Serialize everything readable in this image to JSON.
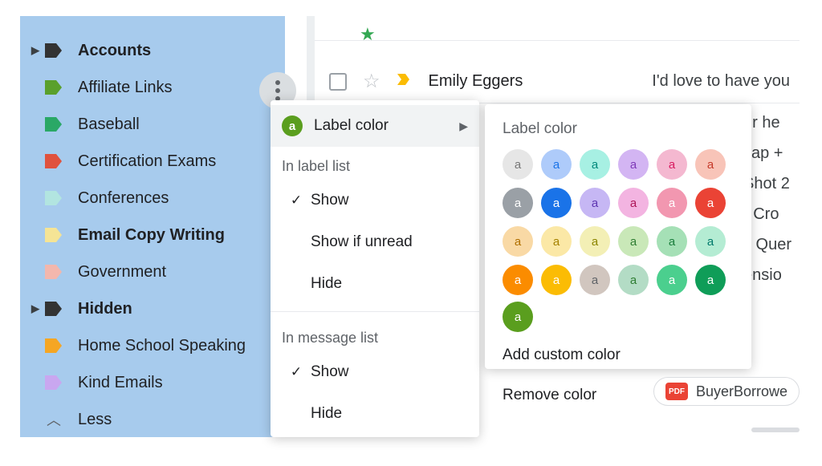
{
  "sidebar": {
    "items": [
      {
        "label": "Accounts",
        "color": "#333333",
        "bold": true,
        "expandable": true
      },
      {
        "label": "Affiliate Links",
        "color": "#5aa02c",
        "bold": false,
        "expandable": false
      },
      {
        "label": "Baseball",
        "color": "#2aa866",
        "bold": false,
        "expandable": false
      },
      {
        "label": "Certification Exams",
        "color": "#e0523e",
        "bold": false,
        "expandable": false
      },
      {
        "label": "Conferences",
        "color": "#b2e5e0",
        "bold": false,
        "expandable": false
      },
      {
        "label": "Email Copy Writing",
        "color": "#f5e495",
        "bold": true,
        "expandable": false
      },
      {
        "label": "Government",
        "color": "#f3b7ad",
        "bold": false,
        "expandable": false
      },
      {
        "label": "Hidden",
        "color": "#333333",
        "bold": true,
        "expandable": true
      },
      {
        "label": "Home School Speaking",
        "color": "#f5a623",
        "bold": false,
        "expandable": false
      },
      {
        "label": "Kind Emails",
        "color": "#c9a7f0",
        "bold": false,
        "expandable": false
      }
    ],
    "less": "Less"
  },
  "mail_row": {
    "sender": "Emily Eggers",
    "subject": "I'd love to have you"
  },
  "peek_snippets": [
    "ur he",
    "cap +",
    "Shot 2",
    "r Cro",
    "s Quer",
    "ensio"
  ],
  "attachment": {
    "name": "BuyerBorrowe",
    "type": "PDF"
  },
  "menu": {
    "label_color": "Label color",
    "section1": "In label list",
    "show": "Show",
    "show_if_unread": "Show if unread",
    "hide": "Hide",
    "section2": "In message list"
  },
  "flyout": {
    "title": "Label color",
    "add_custom": "Add custom color",
    "remove": "Remove color",
    "current_color": "#5a9e1e",
    "swatches": [
      {
        "bg": "#e6e6e6",
        "fg": "#777"
      },
      {
        "bg": "#aecbfa",
        "fg": "#1a73e8"
      },
      {
        "bg": "#a7f0e3",
        "fg": "#00897b"
      },
      {
        "bg": "#d3b5f3",
        "fg": "#7e38b7"
      },
      {
        "bg": "#f4b8d0",
        "fg": "#d81b60"
      },
      {
        "bg": "#f8c4b8",
        "fg": "#c53929"
      },
      {
        "bg": "#9aa0a6",
        "fg": "#fff"
      },
      {
        "bg": "#1a73e8",
        "fg": "#fff"
      },
      {
        "bg": "#c6b7f4",
        "fg": "#5e35b1"
      },
      {
        "bg": "#f3b4e1",
        "fg": "#ad1457"
      },
      {
        "bg": "#f297b0",
        "fg": "#fff"
      },
      {
        "bg": "#ea4335",
        "fg": "#fff"
      },
      {
        "bg": "#f9d9a5",
        "fg": "#b06f00"
      },
      {
        "bg": "#fbe8a6",
        "fg": "#a58100"
      },
      {
        "bg": "#f3efb5",
        "fg": "#8c8500"
      },
      {
        "bg": "#c9e8b8",
        "fg": "#2e7d32"
      },
      {
        "bg": "#a5e0b6",
        "fg": "#1b7e3d"
      },
      {
        "bg": "#b4ecd3",
        "fg": "#00796b"
      },
      {
        "bg": "#fb8c00",
        "fg": "#fff"
      },
      {
        "bg": "#fbbc04",
        "fg": "#fff"
      },
      {
        "bg": "#d1c6bf",
        "fg": "#5f6368"
      },
      {
        "bg": "#b3dcc5",
        "fg": "#2e7d32"
      },
      {
        "bg": "#4bcf8e",
        "fg": "#fff"
      },
      {
        "bg": "#0f9d58",
        "fg": "#fff"
      }
    ]
  }
}
